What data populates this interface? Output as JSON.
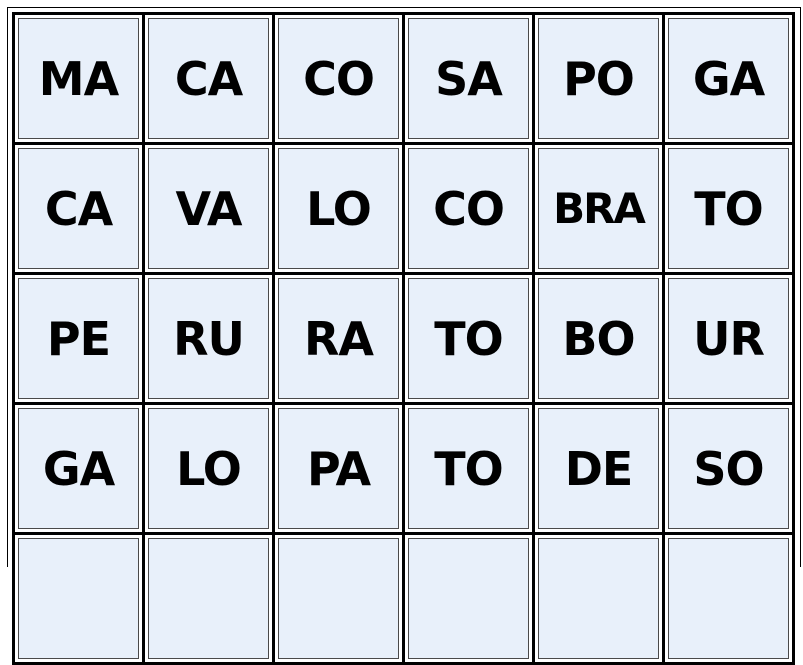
{
  "worksheet": {
    "cell_background": "#e8f0fa",
    "grid_color": "#000000",
    "rows": [
      [
        "MA",
        "CA",
        "CO",
        "SA",
        "PO",
        "GA"
      ],
      [
        "CA",
        "VA",
        "LO",
        "CO",
        "BRA",
        "TO"
      ],
      [
        "PE",
        "RU",
        "RA",
        "TO",
        "BO",
        "UR"
      ],
      [
        "GA",
        "LO",
        "PA",
        "TO",
        "DE",
        "SO"
      ],
      [
        "",
        "",
        "",
        "",
        "",
        ""
      ]
    ]
  }
}
